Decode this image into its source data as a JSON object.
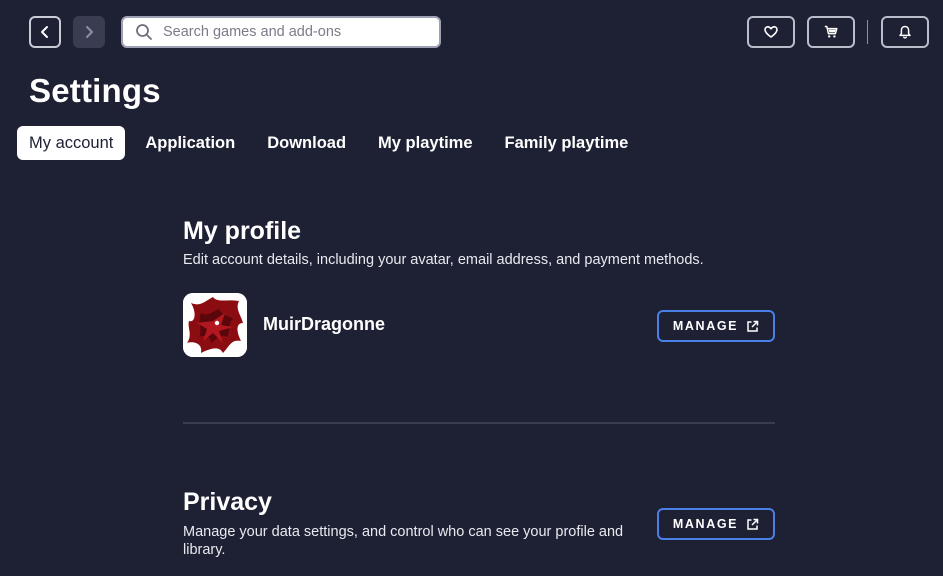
{
  "header": {
    "search_placeholder": "Search games and add-ons"
  },
  "page_title": "Settings",
  "tabs": [
    {
      "label": "My account",
      "active": true
    },
    {
      "label": "Application",
      "active": false
    },
    {
      "label": "Download",
      "active": false
    },
    {
      "label": "My playtime",
      "active": false
    },
    {
      "label": "Family playtime",
      "active": false
    }
  ],
  "profile": {
    "title": "My profile",
    "description": "Edit account details, including your avatar, email address, and payment methods.",
    "username": "MuirDragonne",
    "manage_label": "MANAGE"
  },
  "privacy": {
    "title": "Privacy",
    "description_line1": "Manage your data settings, and control who can see your profile and",
    "description_line2": "library.",
    "manage_label": "MANAGE"
  },
  "colors": {
    "background": "#1e2033",
    "accent_border": "#4a7fe6",
    "avatar_red": "#8b0d12"
  },
  "icons": [
    "chevron-left-icon",
    "chevron-right-icon",
    "search-icon",
    "heart-icon",
    "cart-icon",
    "bell-icon",
    "external-link-icon"
  ]
}
